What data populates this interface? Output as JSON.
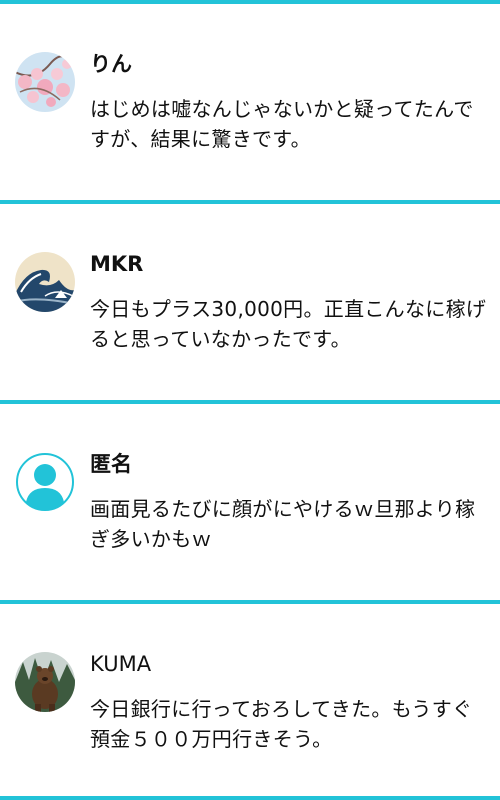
{
  "accent_color": "#22c3d8",
  "reviews": [
    {
      "name": "りん",
      "avatar": "cherry-blossom-avatar",
      "text": "はじめは嘘なんじゃないかと疑ってたんですが、結果に驚きです。"
    },
    {
      "name": "MKR",
      "avatar": "great-wave-avatar",
      "text": "今日もプラス30,000円。正直こんなに稼げると思っていなかったです。"
    },
    {
      "name": "匿名",
      "avatar": "default-user-avatar",
      "text": "画面見るたびに顔がにやけるｗ旦那より稼ぎ多いかもｗ"
    },
    {
      "name": "KUMA",
      "avatar": "bear-photo-avatar",
      "text": "今日銀行に行っておろしてきた。もうすぐ預金５００万円行きそう。"
    }
  ]
}
